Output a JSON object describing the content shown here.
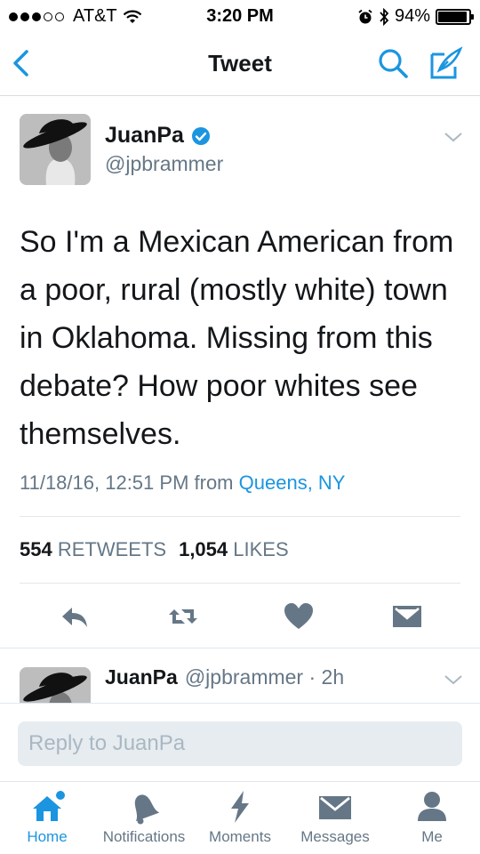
{
  "status_bar": {
    "carrier": "AT&T",
    "time": "3:20 PM",
    "battery": "94%",
    "battery_level": 0.94
  },
  "nav": {
    "title": "Tweet"
  },
  "tweet": {
    "display_name": "JuanPa",
    "handle": "@jpbrammer",
    "text": "So I'm a Mexican American from a poor, rural (mostly white) town in Oklahoma. Missing from this debate? How poor whites see themselves.",
    "timestamp": "11/18/16, 12:51 PM from",
    "location": "Queens, NY",
    "retweets_count": "554",
    "retweets_label": "RETWEETS",
    "likes_count": "1,054",
    "likes_label": "LIKES"
  },
  "reply_preview": {
    "display_name": "JuanPa",
    "meta": "@jpbrammer · 2h"
  },
  "composer": {
    "placeholder": "Reply to JuanPa"
  },
  "tabs": [
    {
      "label": "Home",
      "icon": "home-icon",
      "active": true
    },
    {
      "label": "Notifications",
      "icon": "bell-icon",
      "active": false
    },
    {
      "label": "Moments",
      "icon": "lightning-icon",
      "active": false
    },
    {
      "label": "Messages",
      "icon": "envelope-icon",
      "active": false
    },
    {
      "label": "Me",
      "icon": "person-icon",
      "active": false
    }
  ],
  "colors": {
    "accent": "#1b95e0",
    "secondary_text": "#657786",
    "icon_gray": "#aab8c2"
  }
}
